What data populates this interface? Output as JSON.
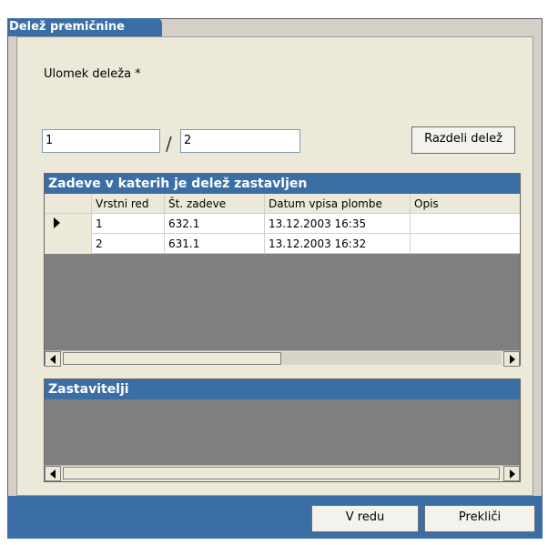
{
  "window": {
    "title": "Delež premičnine"
  },
  "form": {
    "fraction_label": "Ulomek deleža *",
    "numerator": "1",
    "denominator": "2",
    "slash": "/",
    "split_button": "Razdeli delež"
  },
  "cases_table": {
    "title": "Zadeve v katerih je delež zastavljen",
    "columns": [
      "Vrstni red",
      "Št. zadeve",
      "Datum vpisa plombe",
      "Opis"
    ],
    "rows": [
      [
        "1",
        "632.1",
        "13.12.2003 16:35",
        ""
      ],
      [
        "2",
        "631.1",
        "13.12.2003 16:32",
        ""
      ]
    ]
  },
  "pledgers": {
    "title": "Zastavitelji"
  },
  "footer": {
    "ok": "V redu",
    "cancel": "Prekliči"
  }
}
